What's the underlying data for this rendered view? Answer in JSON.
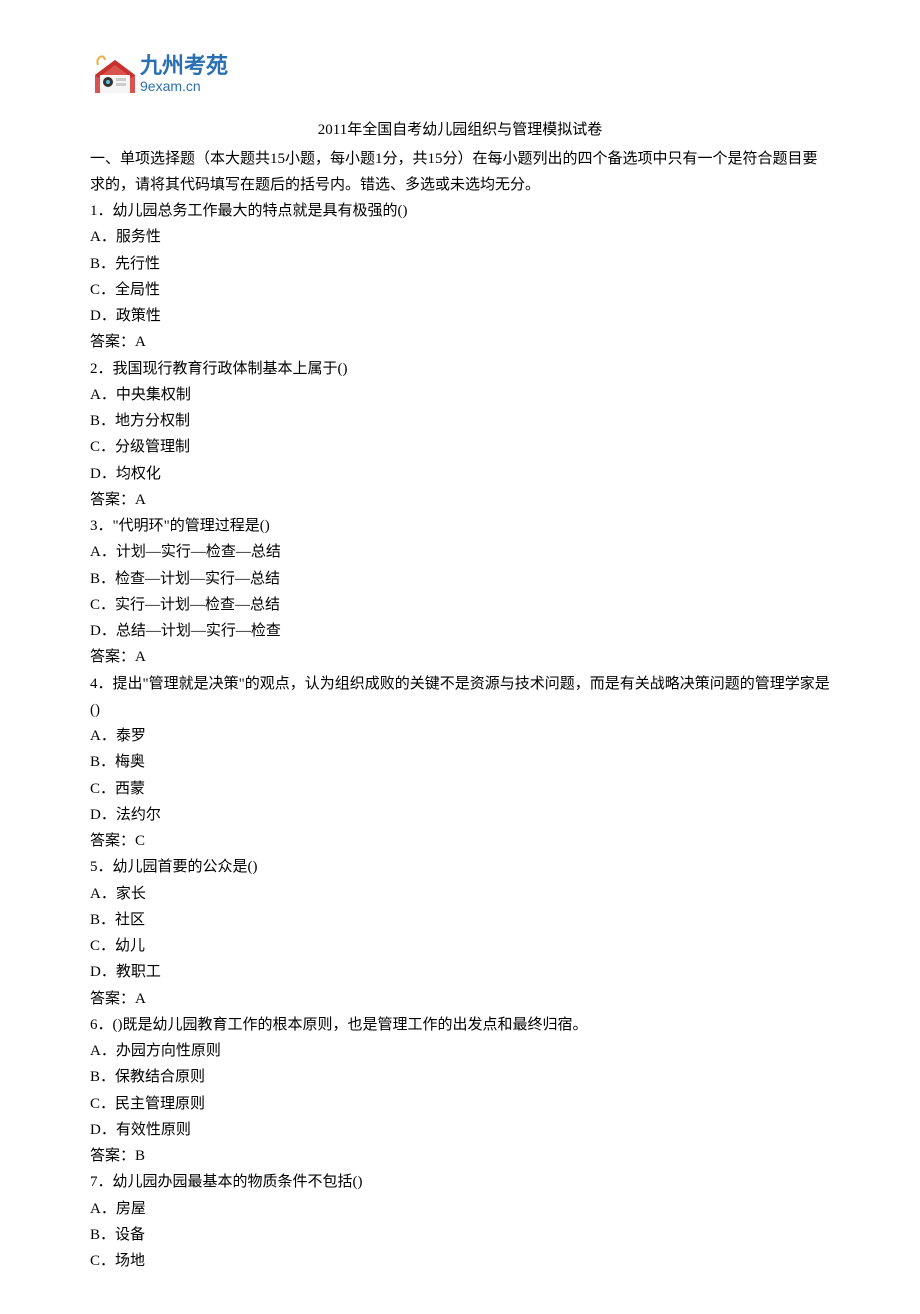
{
  "logo": {
    "brand_text": "九州考苑",
    "domain_text": "9exam.cn"
  },
  "title": "2011年全国自考幼儿园组织与管理模拟试卷",
  "section_intro": "一、单项选择题（本大题共15小题，每小题1分，共15分）在每小题列出的四个备选项中只有一个是符合题目要求的，请将其代码填写在题后的括号内。错选、多选或未选均无分。",
  "questions": [
    {
      "stem": "1．幼儿园总务工作最大的特点就是具有极强的()",
      "options": [
        "A．服务性",
        "B．先行性",
        "C．全局性",
        "D．政策性"
      ],
      "answer": "答案：A"
    },
    {
      "stem": "2．我国现行教育行政体制基本上属于()",
      "options": [
        "A．中央集权制",
        "B．地方分权制",
        "C．分级管理制",
        "D．均权化"
      ],
      "answer": "答案：A"
    },
    {
      "stem": "3．\"代明环\"的管理过程是()",
      "options": [
        "A．计划—实行—检查—总结",
        "B．检查—计划—实行—总结",
        "C．实行—计划—检查—总结",
        "D．总结—计划—实行—检查"
      ],
      "answer": "答案：A"
    },
    {
      "stem": "4．提出\"管理就是决策\"的观点，认为组织成败的关键不是资源与技术问题，而是有关战略决策问题的管理学家是()",
      "options": [
        "A．泰罗",
        "B．梅奥",
        "C．西蒙",
        "D．法约尔"
      ],
      "answer": "答案：C"
    },
    {
      "stem": "5．幼儿园首要的公众是()",
      "options": [
        "A．家长",
        "B．社区",
        "C．幼儿",
        "D．教职工"
      ],
      "answer": "答案：A"
    },
    {
      "stem": "6．()既是幼儿园教育工作的根本原则，也是管理工作的出发点和最终归宿。",
      "options": [
        "A．办园方向性原则",
        "B．保教结合原则",
        "C．民主管理原则",
        "D．有效性原则"
      ],
      "answer": "答案：B"
    },
    {
      "stem": "7．幼儿园办园最基本的物质条件不包括()",
      "options": [
        "A．房屋",
        "B．设备",
        "C．场地"
      ],
      "answer": ""
    }
  ]
}
